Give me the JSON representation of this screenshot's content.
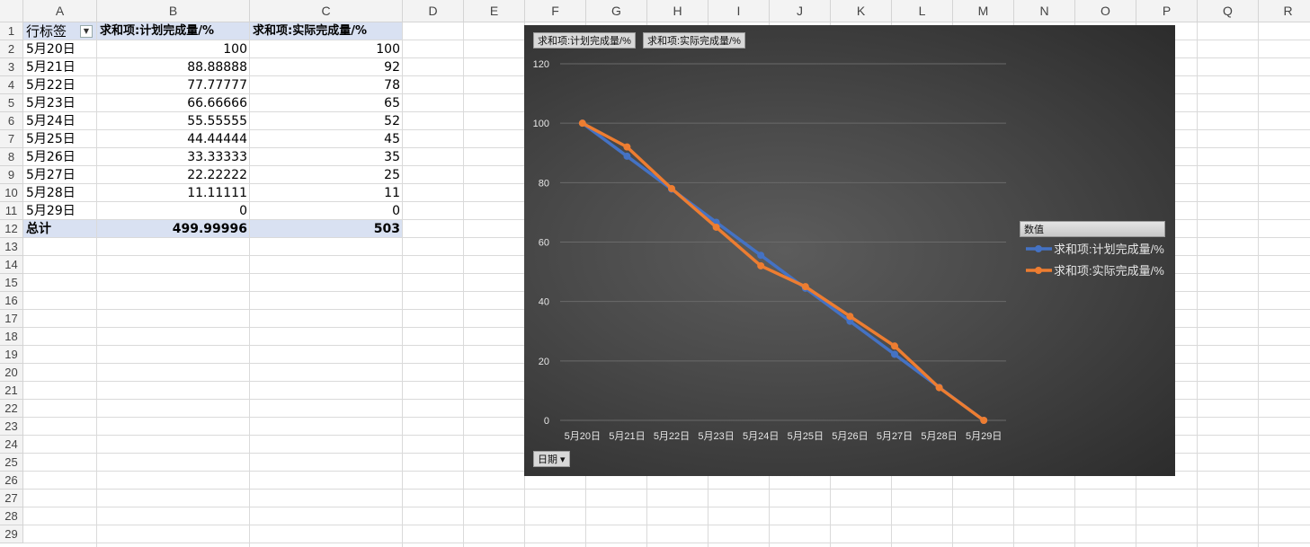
{
  "spreadsheet": {
    "columns": [
      "A",
      "B",
      "C",
      "D",
      "E",
      "F",
      "G",
      "H",
      "I",
      "J",
      "K",
      "L",
      "M",
      "N",
      "O",
      "P",
      "Q",
      "R"
    ],
    "rows": [
      "1",
      "2",
      "3",
      "4",
      "5",
      "6",
      "7",
      "8",
      "9",
      "10",
      "11",
      "12",
      "13",
      "14",
      "15",
      "16",
      "17",
      "18",
      "19",
      "20",
      "21",
      "22",
      "23",
      "24",
      "25",
      "26",
      "27",
      "28",
      "29"
    ],
    "pivot": {
      "row_label_header": "行标签",
      "filter_arrow": "▼",
      "col_b_header": "求和项:计划完成量/%",
      "col_c_header": "求和项:实际完成量/%",
      "rows": [
        {
          "label": "5月20日",
          "planned": "100",
          "actual": "100"
        },
        {
          "label": "5月21日",
          "planned": "88.88888",
          "actual": "92"
        },
        {
          "label": "5月22日",
          "planned": "77.77777",
          "actual": "78"
        },
        {
          "label": "5月23日",
          "planned": "66.66666",
          "actual": "65"
        },
        {
          "label": "5月24日",
          "planned": "55.55555",
          "actual": "52"
        },
        {
          "label": "5月25日",
          "planned": "44.44444",
          "actual": "45"
        },
        {
          "label": "5月26日",
          "planned": "33.33333",
          "actual": "35"
        },
        {
          "label": "5月27日",
          "planned": "22.22222",
          "actual": "25"
        },
        {
          "label": "5月28日",
          "planned": "11.11111",
          "actual": "11"
        },
        {
          "label": "5月29日",
          "planned": "0",
          "actual": "0"
        }
      ],
      "total": {
        "label": "总计",
        "planned": "499.99996",
        "actual": "503"
      }
    }
  },
  "chart": {
    "value_buttons": [
      "求和项:计划完成量/%",
      "求和项:实际完成量/%"
    ],
    "axis_field_button": "日期 ▾",
    "legend_title": "数值",
    "colors": {
      "planned": "#4472c4",
      "actual": "#ed7d31",
      "axis_text": "#e6e6e6",
      "grid": "#6a6a6a"
    }
  },
  "chart_data": {
    "type": "line",
    "categories": [
      "5月20日",
      "5月21日",
      "5月22日",
      "5月23日",
      "5月24日",
      "5月25日",
      "5月26日",
      "5月27日",
      "5月28日",
      "5月29日"
    ],
    "series": [
      {
        "name": "求和项:计划完成量/%",
        "values": [
          100,
          88.88888,
          77.77777,
          66.66666,
          55.55555,
          44.44444,
          33.33333,
          22.22222,
          11.11111,
          0
        ]
      },
      {
        "name": "求和项:实际完成量/%",
        "values": [
          100,
          92,
          78,
          65,
          52,
          45,
          35,
          25,
          11,
          0
        ]
      }
    ],
    "yticks": [
      0,
      20,
      40,
      60,
      80,
      100,
      120
    ],
    "ylim": [
      0,
      120
    ],
    "grid": true,
    "legend_position": "right"
  }
}
